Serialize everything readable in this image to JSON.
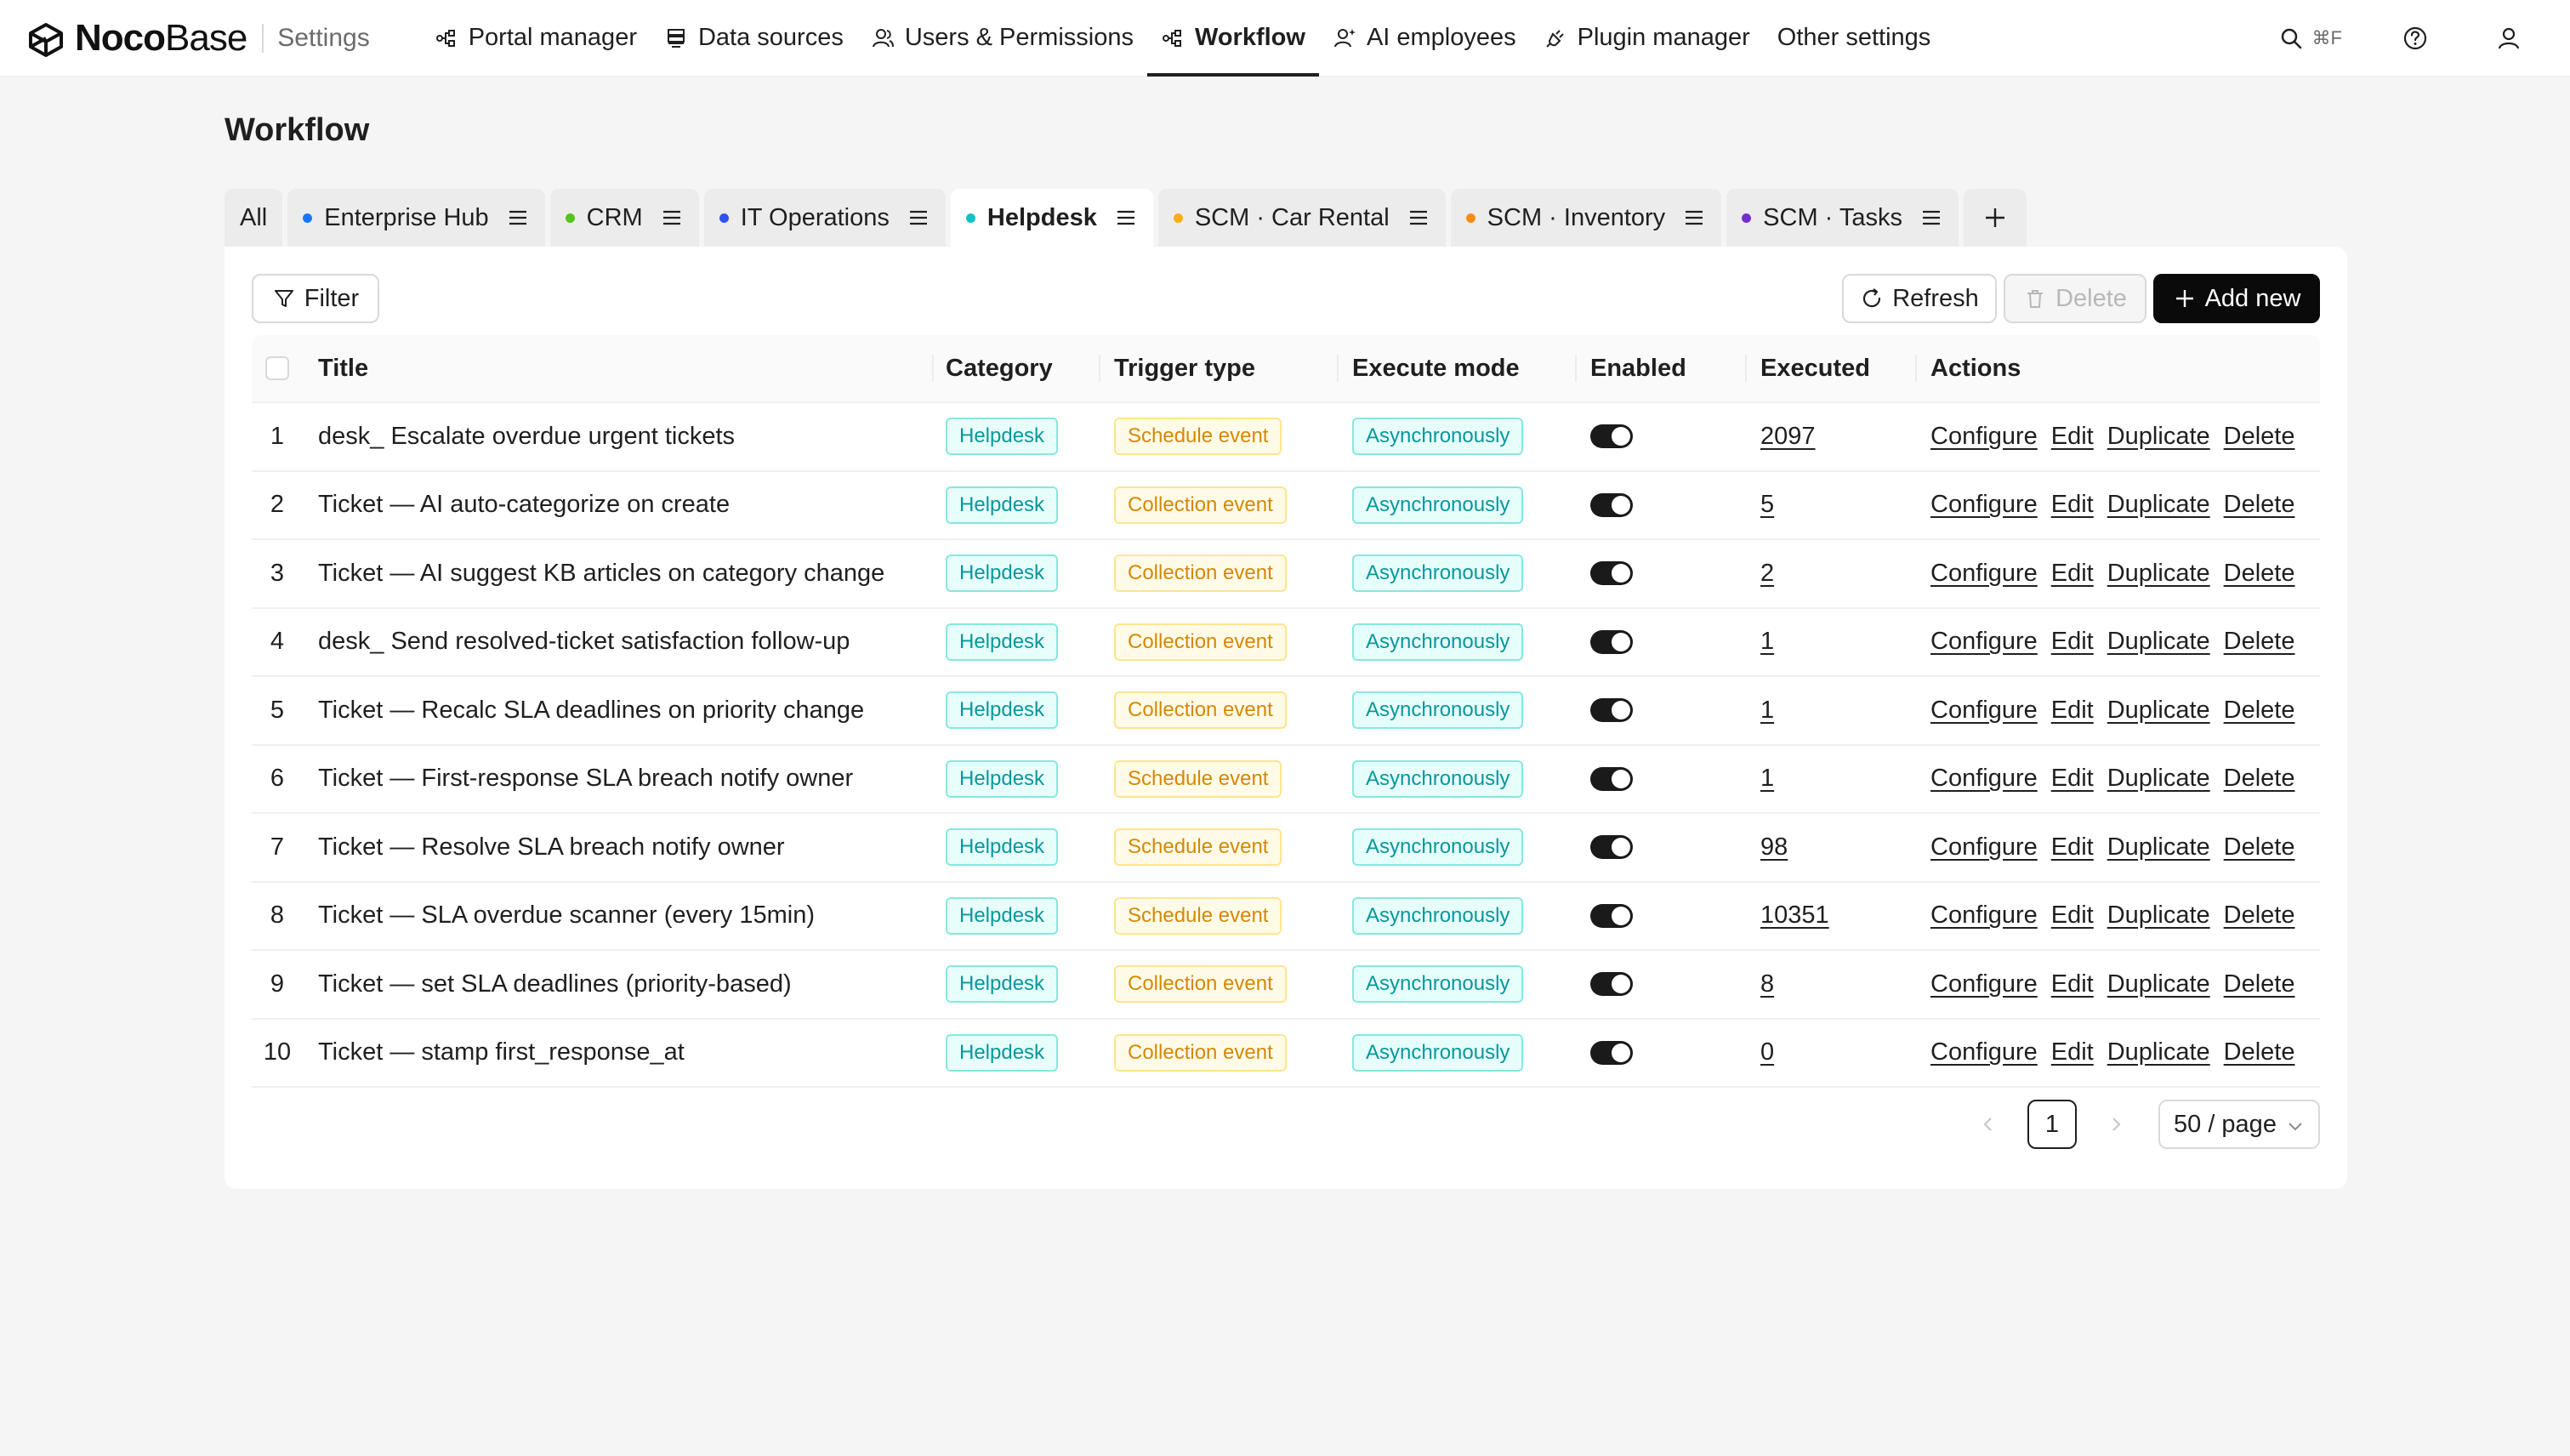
{
  "app": {
    "logo_noco": "Noco",
    "logo_base": "Base",
    "section": "Settings"
  },
  "nav": [
    {
      "label": "Portal manager",
      "icon": "portal-icon"
    },
    {
      "label": "Data sources",
      "icon": "database-icon"
    },
    {
      "label": "Users & Permissions",
      "icon": "users-icon"
    },
    {
      "label": "Workflow",
      "icon": "workflow-icon",
      "active": true
    },
    {
      "label": "AI employees",
      "icon": "ai-employee-icon"
    },
    {
      "label": "Plugin manager",
      "icon": "plugin-icon"
    },
    {
      "label": "Other settings",
      "icon": ""
    }
  ],
  "topbar": {
    "search_shortcut": "⌘F"
  },
  "page": {
    "title": "Workflow"
  },
  "tabs": [
    {
      "label": "All",
      "dot": ""
    },
    {
      "label": "Enterprise Hub",
      "dot": "#1677ff"
    },
    {
      "label": "CRM",
      "dot": "#52c41a"
    },
    {
      "label": "IT Operations",
      "dot": "#2f54eb"
    },
    {
      "label": "Helpdesk",
      "dot": "#13c2c2",
      "active": true
    },
    {
      "label": "SCM · Car Rental",
      "dot": "#faad14"
    },
    {
      "label": "SCM · Inventory",
      "dot": "#fa8c16"
    },
    {
      "label": "SCM · Tasks",
      "dot": "#722ed1"
    }
  ],
  "toolbar": {
    "filter": "Filter",
    "refresh": "Refresh",
    "delete": "Delete",
    "add_new": "Add new"
  },
  "table": {
    "columns": [
      "Title",
      "Category",
      "Trigger type",
      "Execute mode",
      "Enabled",
      "Executed",
      "Actions"
    ],
    "actions": [
      "Configure",
      "Edit",
      "Duplicate",
      "Delete"
    ],
    "rows": [
      {
        "num": "1",
        "title": "desk_ Escalate overdue urgent tickets",
        "category": "Helpdesk",
        "trigger": "Schedule event",
        "mode": "Asynchronously",
        "enabled": true,
        "executed": "2097"
      },
      {
        "num": "2",
        "title": "Ticket — AI auto-categorize on create",
        "category": "Helpdesk",
        "trigger": "Collection event",
        "mode": "Asynchronously",
        "enabled": true,
        "executed": "5"
      },
      {
        "num": "3",
        "title": "Ticket — AI suggest KB articles on category change",
        "category": "Helpdesk",
        "trigger": "Collection event",
        "mode": "Asynchronously",
        "enabled": true,
        "executed": "2"
      },
      {
        "num": "4",
        "title": "desk_ Send resolved-ticket satisfaction follow-up",
        "category": "Helpdesk",
        "trigger": "Collection event",
        "mode": "Asynchronously",
        "enabled": true,
        "executed": "1"
      },
      {
        "num": "5",
        "title": "Ticket — Recalc SLA deadlines on priority change",
        "category": "Helpdesk",
        "trigger": "Collection event",
        "mode": "Asynchronously",
        "enabled": true,
        "executed": "1"
      },
      {
        "num": "6",
        "title": "Ticket — First-response SLA breach notify owner",
        "category": "Helpdesk",
        "trigger": "Schedule event",
        "mode": "Asynchronously",
        "enabled": true,
        "executed": "1"
      },
      {
        "num": "7",
        "title": "Ticket — Resolve SLA breach notify owner",
        "category": "Helpdesk",
        "trigger": "Schedule event",
        "mode": "Asynchronously",
        "enabled": true,
        "executed": "98"
      },
      {
        "num": "8",
        "title": "Ticket — SLA overdue scanner (every 15min)",
        "category": "Helpdesk",
        "trigger": "Schedule event",
        "mode": "Asynchronously",
        "enabled": true,
        "executed": "10351"
      },
      {
        "num": "9",
        "title": "Ticket — set SLA deadlines (priority-based)",
        "category": "Helpdesk",
        "trigger": "Collection event",
        "mode": "Asynchronously",
        "enabled": true,
        "executed": "8"
      },
      {
        "num": "10",
        "title": "Ticket — stamp first_response_at",
        "category": "Helpdesk",
        "trigger": "Collection event",
        "mode": "Asynchronously",
        "enabled": true,
        "executed": "0"
      }
    ]
  },
  "pagination": {
    "current": "1",
    "page_size": "50 / page"
  },
  "colors": {
    "tag_category": "#08979c",
    "tag_trigger": "#d48806",
    "tag_mode": "#08979c",
    "primary": "#0a0a0a"
  }
}
